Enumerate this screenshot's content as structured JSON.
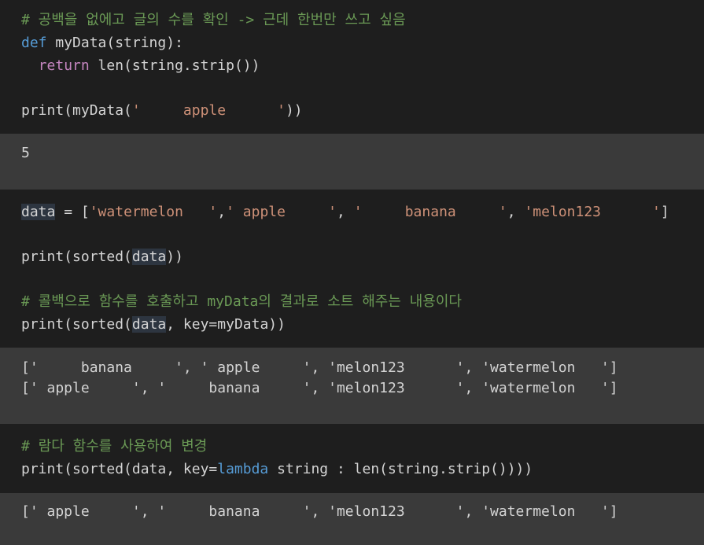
{
  "cell1": {
    "comment": "# 공백을 없에고 글의 수를 확인 -> 근데 한번만 쓰고 싶음",
    "l2_def": "def",
    "l2_rest": " myData(string):",
    "l3_indent": "  ",
    "l3_return": "return",
    "l3_rest": " len(string.strip())",
    "l5_pre": "print(myData(",
    "l5_str": "'     apple      '",
    "l5_post": "))"
  },
  "out1": {
    "line1": "5"
  },
  "cell2": {
    "l1_var": "data",
    "l1_eq": " = [",
    "l1_s1": "'watermelon   '",
    "l1_c1": ",",
    "l1_s2": "' apple     '",
    "l1_c2": ", ",
    "l1_s3": "'     banana     '",
    "l1_c3": ", ",
    "l1_s4": "'melon123      '",
    "l1_end": "]",
    "l3_pre": "print(sorted(",
    "l3_var": "data",
    "l3_post": "))",
    "comment": "# 콜백으로 함수를 호출하고 myData의 결과로 소트 해주는 내용이다",
    "l6_pre": "print(sorted(",
    "l6_var": "data",
    "l6_post": ", key=myData))"
  },
  "out2": {
    "line1": "['     banana     ', ' apple     ', 'melon123      ', 'watermelon   ']",
    "line2": "[' apple     ', '     banana     ', 'melon123      ', 'watermelon   ']"
  },
  "cell3": {
    "comment": "# 람다 함수를 사용하여 변경",
    "l2_pre": "print(sorted(data, key=",
    "l2_lambda": "lambda",
    "l2_post": " string : len(string.strip())))"
  },
  "out3": {
    "line1": "[' apple     ', '     banana     ', 'melon123      ', 'watermelon   ']"
  },
  "colors": {
    "code_bg": "#1e1e1e",
    "output_bg": "#3a3a3a",
    "comment": "#6a9955",
    "keyword": "#569cd6",
    "string": "#ce9178",
    "return_kw": "#c586c0"
  }
}
